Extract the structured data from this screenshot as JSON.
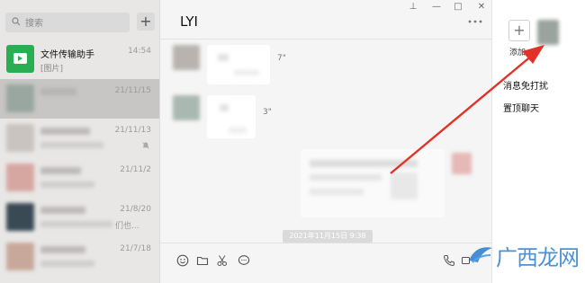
{
  "window": {
    "pin": "⊥",
    "minimize": "—",
    "maximize": "□",
    "close": "✕"
  },
  "search": {
    "placeholder": "搜索",
    "icon": "search-icon",
    "add_label": "+"
  },
  "chats": [
    {
      "name": "文件传输助手",
      "preview": "[图片]",
      "time": "14:54",
      "icon": "folder-icon"
    },
    {
      "name": "",
      "preview": "",
      "time": "21/11/15"
    },
    {
      "name": "",
      "preview": "",
      "time": "21/11/13",
      "muted": true
    },
    {
      "name": "",
      "preview": "",
      "time": "21/11/2"
    },
    {
      "name": "",
      "preview": "们也...",
      "time": "21/8/20"
    },
    {
      "name": "",
      "preview": "",
      "time": "21/7/18"
    }
  ],
  "conversation": {
    "title": "LYI",
    "messages": [
      {
        "type": "voice",
        "from": "other",
        "length": "7\""
      },
      {
        "type": "voice",
        "from": "other",
        "length": "3\""
      },
      {
        "type": "card",
        "from": "me"
      }
    ],
    "timestamp": "2021年11月15日 9:38",
    "toolbar_icons": [
      "emoji-icon",
      "folder-icon",
      "scissors-icon",
      "chat-history-icon"
    ],
    "right_icons": [
      "phone-icon",
      "video-icon"
    ]
  },
  "info_panel": {
    "add_label": "添加",
    "settings": [
      "消息免打扰",
      "置顶聊天"
    ]
  },
  "watermark": {
    "text": "广西龙网"
  },
  "colors": {
    "accent_green": "#2aae54",
    "arrow_red": "#e23126",
    "watermark_blue": "#1a73c8"
  }
}
